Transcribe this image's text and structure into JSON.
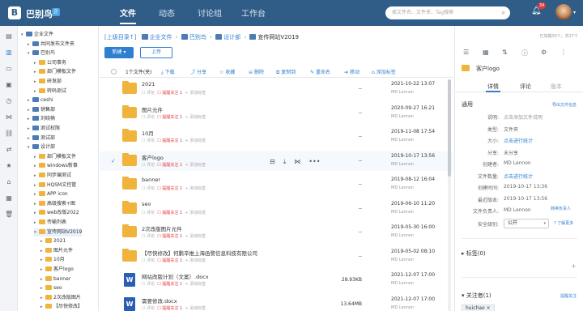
{
  "header": {
    "brand": "巴别鸟",
    "nav": [
      "文件",
      "动态",
      "讨论组",
      "工作台"
    ],
    "search_placeholder": "按文件名、文件夹、Tag搜索",
    "notification_count": "34"
  },
  "tree": {
    "items": [
      {
        "label": "企业文件",
        "depth": 0,
        "open": true
      },
      {
        "label": "共同发布文件夹",
        "depth": 1
      },
      {
        "label": "巴别鸟",
        "depth": 1,
        "open": true
      },
      {
        "label": "公司事务",
        "depth": 2
      },
      {
        "label": "部门模板文件",
        "depth": 2
      },
      {
        "label": "研发部",
        "depth": 2
      },
      {
        "label": "转码测试",
        "depth": 2
      },
      {
        "label": "ceshi",
        "depth": 1
      },
      {
        "label": "销售部",
        "depth": 1
      },
      {
        "label": "刘晓楠",
        "depth": 1
      },
      {
        "label": "测试权限",
        "depth": 1
      },
      {
        "label": "测试部",
        "depth": 1
      },
      {
        "label": "设计部",
        "depth": 1,
        "open": true
      },
      {
        "label": "部门模板文件",
        "depth": 2
      },
      {
        "label": "windows新事",
        "depth": 2
      },
      {
        "label": "同步编测试",
        "depth": 2
      },
      {
        "label": "HQSM文控管",
        "depth": 2
      },
      {
        "label": "APP icon",
        "depth": 2
      },
      {
        "label": "高级搜索+图",
        "depth": 2
      },
      {
        "label": "web改版2022",
        "depth": 2
      },
      {
        "label": "传输列表",
        "depth": 2
      },
      {
        "label": "宣传网站V2019",
        "depth": 2,
        "open": true
      },
      {
        "label": "2021",
        "depth": 3
      },
      {
        "label": "图片元件",
        "depth": 3
      },
      {
        "label": "10月",
        "depth": 3
      },
      {
        "label": "客户logo",
        "depth": 3
      },
      {
        "label": "banner",
        "depth": 3
      },
      {
        "label": "seo",
        "depth": 3
      },
      {
        "label": "2次改版图片",
        "depth": 3
      },
      {
        "label": "【尽快修改】",
        "depth": 3
      }
    ]
  },
  "breadcrumb": {
    "up": "[上级目录↑]",
    "items": [
      "企业文件",
      "巴别鸟",
      "设计部",
      "宣传网站V2019"
    ]
  },
  "actions": {
    "new": "新建",
    "upload": "上传"
  },
  "toolbar": {
    "count": "1个文件(夹)",
    "download": "下载",
    "share": "分享",
    "collect": "收藏",
    "delete": "删除",
    "copy": "复制到",
    "rename": "重命名",
    "move": "移动",
    "tag": "添加标签"
  },
  "row_labels": {
    "comment": "评论",
    "follow": "提醒关注 1",
    "add_tag": "+ 添加标签"
  },
  "files": [
    {
      "name": "2021",
      "type": "folder",
      "size": "--",
      "date": "2021-10-22 13:07",
      "user": "MD Lennon"
    },
    {
      "name": "图片元件",
      "type": "folder",
      "size": "--",
      "date": "2020-09-27 16:21",
      "user": "MD Lennon"
    },
    {
      "name": "10月",
      "type": "folder",
      "size": "--",
      "date": "2019-11-08 17:54",
      "user": "MD Lennon"
    },
    {
      "name": "客户logo",
      "type": "folder",
      "size": "--",
      "date": "2019-10-17 13:56",
      "user": "MD Lennon",
      "selected": true
    },
    {
      "name": "banner",
      "type": "folder",
      "size": "--",
      "date": "2019-08-12 16:04",
      "user": "MD Lennon"
    },
    {
      "name": "seo",
      "type": "folder",
      "size": "--",
      "date": "2019-06-10 11:20",
      "user": "MD Lennon"
    },
    {
      "name": "2次改版图片元件",
      "type": "folder",
      "size": "--",
      "date": "2019-05-30 16:00",
      "user": "MD Lennon"
    },
    {
      "name": "【尽快修改】何鹏辛推上海函警信息科技有限公司",
      "type": "folder",
      "size": "--",
      "date": "2019-05-02 08:10",
      "user": "MD Lennon"
    },
    {
      "name": "网站改版计划（文案）.docx",
      "type": "docx",
      "size": "28.93KB",
      "date": "2021-12-07 17:00",
      "user": "MD Lennon"
    },
    {
      "name": "需要修改.docx",
      "type": "docx",
      "size": "13.64MB",
      "date": "2021-12-07 17:00",
      "user": "MD Lennon"
    }
  ],
  "panel": {
    "stat": "已加载00个，共27个",
    "title": "客户logo",
    "tabs": [
      "详情",
      "评论",
      "版本"
    ],
    "general": "通用",
    "export": "导出文件信息",
    "props": [
      {
        "k": "说明:",
        "v": "点击添加文件说明",
        "style": "muted"
      },
      {
        "k": "类型:",
        "v": "文件夹"
      },
      {
        "k": "大小:",
        "v": "点击进行统计",
        "style": "link"
      },
      {
        "k": "分享:",
        "v": "未分享"
      },
      {
        "k": "创建者:",
        "v": "MD Lennon"
      },
      {
        "k": "文件数量:",
        "v": "点击进行统计",
        "style": "link"
      },
      {
        "k": "创建时间:",
        "v": "2019-10-17 13:36"
      },
      {
        "k": "最近版本:",
        "v": "2019-10-17 13:56"
      },
      {
        "k": "文件负责人:",
        "v": "MD Lennon"
      }
    ],
    "transfer": "转换负责人",
    "security_label": "安全级别:",
    "security_value": "公开",
    "learn_more": "了解更多",
    "tags_title": "标签(0)",
    "followers_title": "关注者(1)",
    "add_follower": "提醒关注",
    "follower": "huichao"
  }
}
